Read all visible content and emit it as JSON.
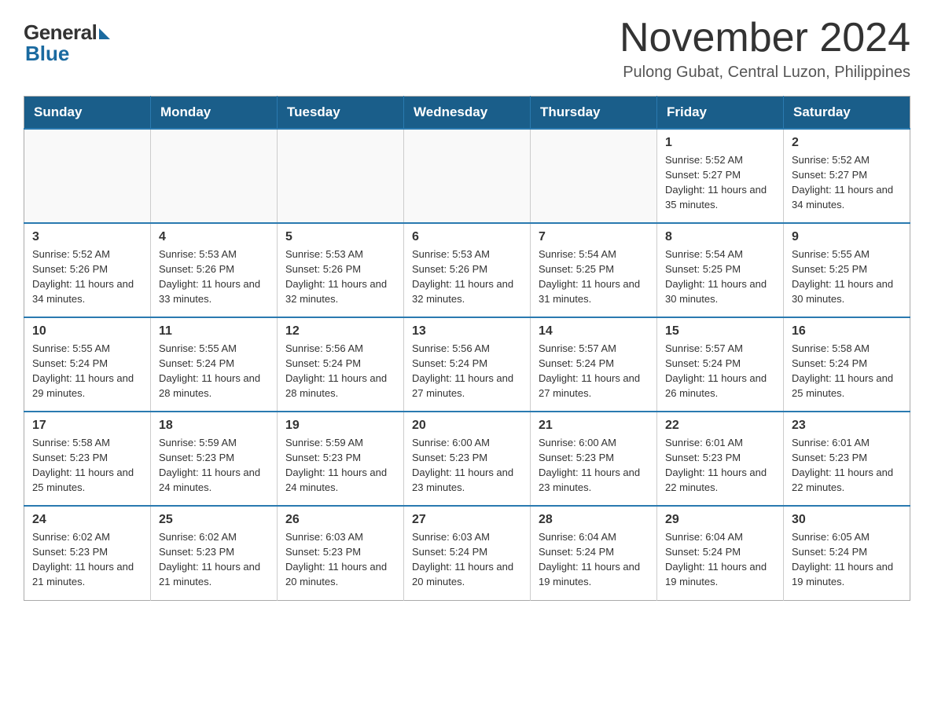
{
  "logo": {
    "general": "General",
    "blue": "Blue"
  },
  "title": "November 2024",
  "subtitle": "Pulong Gubat, Central Luzon, Philippines",
  "weekdays": [
    "Sunday",
    "Monday",
    "Tuesday",
    "Wednesday",
    "Thursday",
    "Friday",
    "Saturday"
  ],
  "weeks": [
    [
      {
        "day": "",
        "info": ""
      },
      {
        "day": "",
        "info": ""
      },
      {
        "day": "",
        "info": ""
      },
      {
        "day": "",
        "info": ""
      },
      {
        "day": "",
        "info": ""
      },
      {
        "day": "1",
        "info": "Sunrise: 5:52 AM\nSunset: 5:27 PM\nDaylight: 11 hours\nand 35 minutes."
      },
      {
        "day": "2",
        "info": "Sunrise: 5:52 AM\nSunset: 5:27 PM\nDaylight: 11 hours\nand 34 minutes."
      }
    ],
    [
      {
        "day": "3",
        "info": "Sunrise: 5:52 AM\nSunset: 5:26 PM\nDaylight: 11 hours\nand 34 minutes."
      },
      {
        "day": "4",
        "info": "Sunrise: 5:53 AM\nSunset: 5:26 PM\nDaylight: 11 hours\nand 33 minutes."
      },
      {
        "day": "5",
        "info": "Sunrise: 5:53 AM\nSunset: 5:26 PM\nDaylight: 11 hours\nand 32 minutes."
      },
      {
        "day": "6",
        "info": "Sunrise: 5:53 AM\nSunset: 5:26 PM\nDaylight: 11 hours\nand 32 minutes."
      },
      {
        "day": "7",
        "info": "Sunrise: 5:54 AM\nSunset: 5:25 PM\nDaylight: 11 hours\nand 31 minutes."
      },
      {
        "day": "8",
        "info": "Sunrise: 5:54 AM\nSunset: 5:25 PM\nDaylight: 11 hours\nand 30 minutes."
      },
      {
        "day": "9",
        "info": "Sunrise: 5:55 AM\nSunset: 5:25 PM\nDaylight: 11 hours\nand 30 minutes."
      }
    ],
    [
      {
        "day": "10",
        "info": "Sunrise: 5:55 AM\nSunset: 5:24 PM\nDaylight: 11 hours\nand 29 minutes."
      },
      {
        "day": "11",
        "info": "Sunrise: 5:55 AM\nSunset: 5:24 PM\nDaylight: 11 hours\nand 28 minutes."
      },
      {
        "day": "12",
        "info": "Sunrise: 5:56 AM\nSunset: 5:24 PM\nDaylight: 11 hours\nand 28 minutes."
      },
      {
        "day": "13",
        "info": "Sunrise: 5:56 AM\nSunset: 5:24 PM\nDaylight: 11 hours\nand 27 minutes."
      },
      {
        "day": "14",
        "info": "Sunrise: 5:57 AM\nSunset: 5:24 PM\nDaylight: 11 hours\nand 27 minutes."
      },
      {
        "day": "15",
        "info": "Sunrise: 5:57 AM\nSunset: 5:24 PM\nDaylight: 11 hours\nand 26 minutes."
      },
      {
        "day": "16",
        "info": "Sunrise: 5:58 AM\nSunset: 5:24 PM\nDaylight: 11 hours\nand 25 minutes."
      }
    ],
    [
      {
        "day": "17",
        "info": "Sunrise: 5:58 AM\nSunset: 5:23 PM\nDaylight: 11 hours\nand 25 minutes."
      },
      {
        "day": "18",
        "info": "Sunrise: 5:59 AM\nSunset: 5:23 PM\nDaylight: 11 hours\nand 24 minutes."
      },
      {
        "day": "19",
        "info": "Sunrise: 5:59 AM\nSunset: 5:23 PM\nDaylight: 11 hours\nand 24 minutes."
      },
      {
        "day": "20",
        "info": "Sunrise: 6:00 AM\nSunset: 5:23 PM\nDaylight: 11 hours\nand 23 minutes."
      },
      {
        "day": "21",
        "info": "Sunrise: 6:00 AM\nSunset: 5:23 PM\nDaylight: 11 hours\nand 23 minutes."
      },
      {
        "day": "22",
        "info": "Sunrise: 6:01 AM\nSunset: 5:23 PM\nDaylight: 11 hours\nand 22 minutes."
      },
      {
        "day": "23",
        "info": "Sunrise: 6:01 AM\nSunset: 5:23 PM\nDaylight: 11 hours\nand 22 minutes."
      }
    ],
    [
      {
        "day": "24",
        "info": "Sunrise: 6:02 AM\nSunset: 5:23 PM\nDaylight: 11 hours\nand 21 minutes."
      },
      {
        "day": "25",
        "info": "Sunrise: 6:02 AM\nSunset: 5:23 PM\nDaylight: 11 hours\nand 21 minutes."
      },
      {
        "day": "26",
        "info": "Sunrise: 6:03 AM\nSunset: 5:23 PM\nDaylight: 11 hours\nand 20 minutes."
      },
      {
        "day": "27",
        "info": "Sunrise: 6:03 AM\nSunset: 5:24 PM\nDaylight: 11 hours\nand 20 minutes."
      },
      {
        "day": "28",
        "info": "Sunrise: 6:04 AM\nSunset: 5:24 PM\nDaylight: 11 hours\nand 19 minutes."
      },
      {
        "day": "29",
        "info": "Sunrise: 6:04 AM\nSunset: 5:24 PM\nDaylight: 11 hours\nand 19 minutes."
      },
      {
        "day": "30",
        "info": "Sunrise: 6:05 AM\nSunset: 5:24 PM\nDaylight: 11 hours\nand 19 minutes."
      }
    ]
  ]
}
